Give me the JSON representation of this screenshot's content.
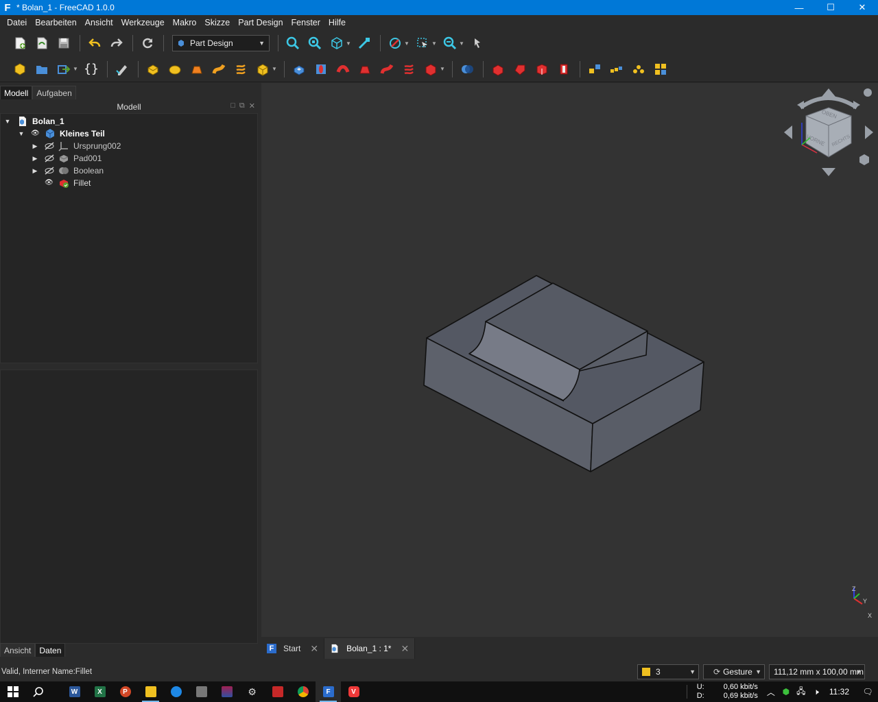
{
  "window": {
    "title": "* Bolan_1 - FreeCAD 1.0.0",
    "app_logo": "F",
    "minimize": "—",
    "maximize": "☐",
    "close": "✕"
  },
  "menu": [
    {
      "label": "Datei"
    },
    {
      "label": "Bearbeiten"
    },
    {
      "label": "Ansicht"
    },
    {
      "label": "Werkzeuge"
    },
    {
      "label": "Makro"
    },
    {
      "label": "Skizze"
    },
    {
      "label": "Part Design"
    },
    {
      "label": "Fenster"
    },
    {
      "label": "Hilfe"
    }
  ],
  "toolbar": {
    "workbench": "Part Design"
  },
  "panel": {
    "tabs": [
      "Modell",
      "Aufgaben"
    ],
    "tree_header": "Modell",
    "tree": [
      {
        "label": "Bolan_1",
        "bold": true
      },
      {
        "label": "Kleines Teil",
        "bold": true
      },
      {
        "label": "Ursprung002"
      },
      {
        "label": "Pad001"
      },
      {
        "label": "Boolean"
      },
      {
        "label": "Fillet"
      }
    ],
    "prop_tabs": [
      "Ansicht",
      "Daten"
    ]
  },
  "viewport": {
    "navcube": {
      "top": "OBEN",
      "front": "VORNE",
      "right": "RECHTS"
    },
    "axis": {
      "z": "Z",
      "y": "Y",
      "x": "X"
    }
  },
  "doc_tabs": [
    {
      "label": "Start"
    },
    {
      "label": "Bolan_1 : 1*"
    }
  ],
  "status": {
    "text": "Valid, Interner Name:Fillet",
    "layer": "3",
    "nav_style": "Gesture",
    "dimensions": "111,12 mm x 100,00 mm"
  },
  "taskbar": {
    "net_up_label": "U:",
    "net_down_label": "D:",
    "net_up": "0,60 kbit/s",
    "net_down": "0,69 kbit/s",
    "time": "11:32"
  }
}
